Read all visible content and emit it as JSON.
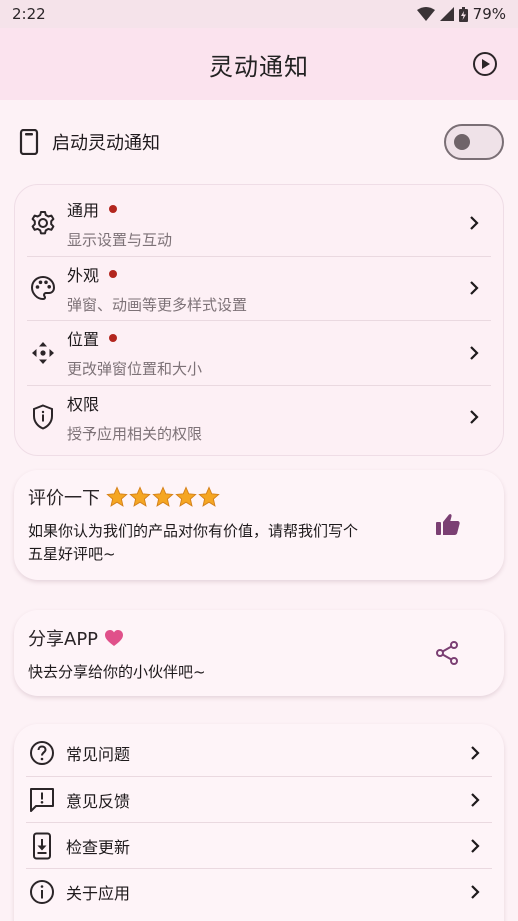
{
  "status": {
    "time": "2:22",
    "battery": "79%"
  },
  "appbar": {
    "title": "灵动通知"
  },
  "master": {
    "label": "启动灵动通知",
    "enabled": false
  },
  "settings": [
    {
      "title": "通用",
      "subtitle": "显示设置与互动",
      "dot": true,
      "icon": "gear-icon"
    },
    {
      "title": "外观",
      "subtitle": "弹窗、动画等更多样式设置",
      "dot": true,
      "icon": "palette-icon"
    },
    {
      "title": "位置",
      "subtitle": "更改弹窗位置和大小",
      "dot": true,
      "icon": "move-icon"
    },
    {
      "title": "权限",
      "subtitle": "授予应用相关的权限",
      "dot": false,
      "icon": "shield-icon"
    }
  ],
  "rate": {
    "title": "评价一下",
    "stars": 5,
    "desc_line1": "如果你认为我们的产品对你有价值，请帮我们写个",
    "desc_line2": "五星好评吧~"
  },
  "share": {
    "title": "分享APP",
    "desc": "快去分享给你的小伙伴吧~"
  },
  "misc": [
    {
      "label": "常见问题",
      "icon": "help-icon"
    },
    {
      "label": "意见反馈",
      "icon": "feedback-icon"
    },
    {
      "label": "检查更新",
      "icon": "update-icon"
    },
    {
      "label": "关于应用",
      "icon": "info-icon"
    }
  ],
  "colors": {
    "accent": "#7b3f73",
    "dot": "#b3261e",
    "star": "#f5a623",
    "heart": "#e0508a"
  }
}
